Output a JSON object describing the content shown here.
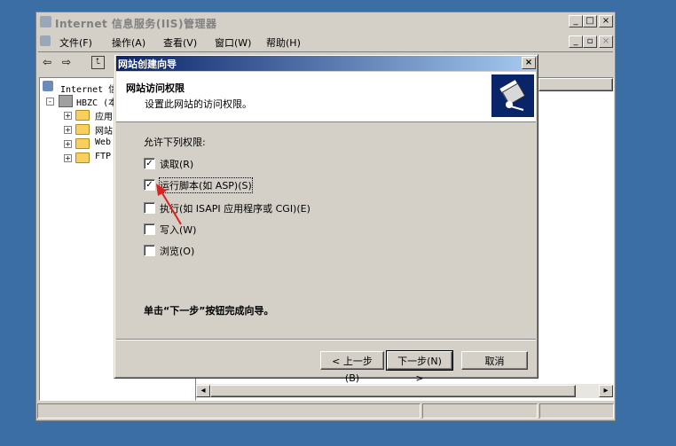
{
  "main_window": {
    "title": "Internet 信息服务(IIS)管理器",
    "menu": [
      "文件(F)",
      "操作(A)",
      "查看(V)",
      "窗口(W)",
      "帮助(H)"
    ],
    "tree": {
      "root": "Internet 信",
      "server": "HBZC (本",
      "children": [
        "应用",
        "网站",
        "Web",
        "FTP"
      ]
    }
  },
  "dialog": {
    "title": "网站创建向导",
    "header_title": "网站访问权限",
    "header_subtitle": "设置此网站的访问权限。",
    "section_label": "允许下列权限:",
    "permissions": [
      {
        "label": "读取(R)",
        "checked": true
      },
      {
        "label": "运行脚本(如 ASP)(S)",
        "checked": true
      },
      {
        "label": "执行(如 ISAPI 应用程序或 CGI)(E)",
        "checked": false
      },
      {
        "label": "写入(W)",
        "checked": false
      },
      {
        "label": "浏览(O)",
        "checked": false
      }
    ],
    "instruction": "单击“下一步”按钮完成向导。",
    "buttons": {
      "back": "< 上一步(B)",
      "next": "下一步(N) >",
      "cancel": "取消"
    }
  },
  "colors": {
    "desktop": "#3a6ea5",
    "dialog_title_start": "#0a246a",
    "dialog_title_end": "#a6caf0",
    "annotation_arrow": "#e02020"
  }
}
